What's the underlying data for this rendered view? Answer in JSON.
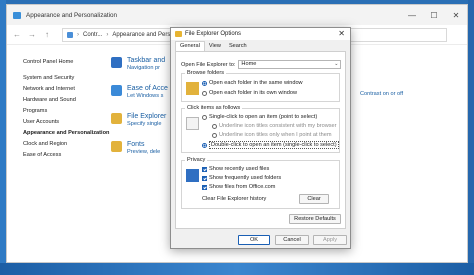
{
  "window": {
    "title": "Appearance and Personalization",
    "controls": {
      "minimize": "—",
      "maximize": "☐",
      "close": "✕"
    }
  },
  "addressbar": {
    "back": "←",
    "forward": "→",
    "up": "↑",
    "crumbs": [
      "Contr...",
      "Appearance and Personalization"
    ],
    "separator": "›"
  },
  "sidebar": {
    "home": "Control Panel Home",
    "items": [
      "System and Security",
      "Network and Internet",
      "Hardware and Sound",
      "Programs",
      "User Accounts",
      "Appearance and Personalization",
      "Clock and Region",
      "Ease of Access"
    ]
  },
  "categories": [
    {
      "title": "Taskbar and",
      "sub": "Navigation pr",
      "color": "#2f6fc2"
    },
    {
      "title": "Ease of Acce",
      "sub": "Let Windows s",
      "color": "#3b8ad8"
    },
    {
      "title": "File Explorer",
      "sub": "Specify single",
      "color": "#e2b23c"
    },
    {
      "title": "Fonts",
      "sub": "Preview, dele",
      "color": "#e2b23c"
    }
  ],
  "right_text": "Contrast on or off",
  "dialog": {
    "title": "File Explorer Options",
    "close": "✕",
    "tabs": [
      "General",
      "View",
      "Search"
    ],
    "open_label": "Open File Explorer to:",
    "open_value": "Home",
    "browse": {
      "legend": "Browse folders",
      "options": [
        "Open each folder in the same window",
        "Open each folder in its own window"
      ]
    },
    "click": {
      "legend": "Click items as follows",
      "single": "Single-click to open an item (point to select)",
      "sub1": "Underline icon titles consistent with my browser",
      "sub2": "Underline icon titles only when I point at them",
      "double": "Double-click to open an item (single-click to select)"
    },
    "privacy": {
      "legend": "Privacy",
      "checks": [
        "Show recently used files",
        "Show frequently used folders",
        "Show files from Office.com"
      ],
      "clear_label": "Clear File Explorer history",
      "clear_button": "Clear"
    },
    "restore": "Restore Defaults",
    "buttons": {
      "ok": "OK",
      "cancel": "Cancel",
      "apply": "Apply"
    }
  }
}
